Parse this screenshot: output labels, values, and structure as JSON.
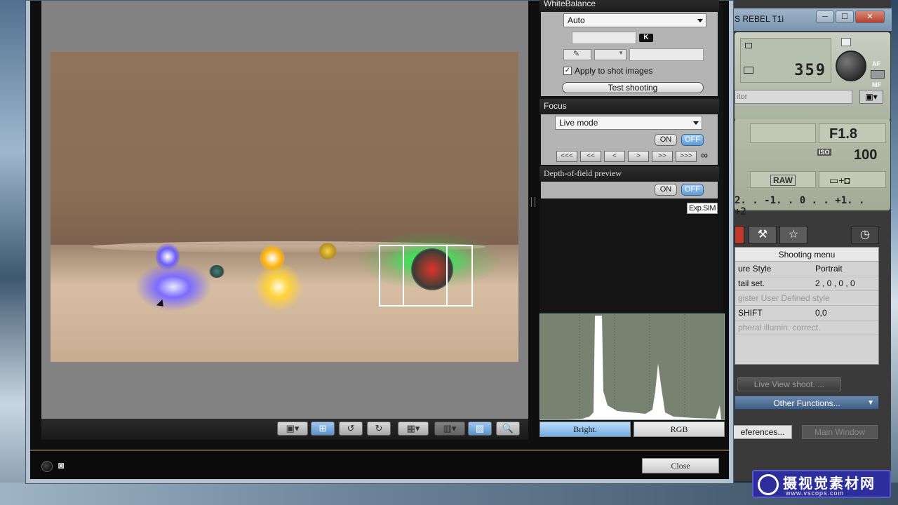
{
  "camera_window": {
    "title": "S REBEL T1i",
    "minimize": "─",
    "maximize": "☐",
    "close": "✕",
    "shots_remaining": "359",
    "af_label": "AF",
    "mf_label": "MF",
    "monitor_field": "itor",
    "aperture": "F1.8",
    "iso_label": "ISO",
    "iso": "100",
    "quality": "RAW",
    "exposure_scale": "2. . -1. . 0 . . +1. . +2",
    "menu": {
      "header": "Shooting menu",
      "rows": [
        {
          "key": "ure Style",
          "value": "Portrait",
          "dim": false
        },
        {
          "key": "tail set.",
          "value": "2 , 0 , 0 , 0",
          "dim": false
        },
        {
          "key": "gister User Defined style",
          "value": "",
          "dim": true
        },
        {
          "key": "SHIFT",
          "value": "0,0",
          "dim": false
        },
        {
          "key": "pheral illumin. correct.",
          "value": "",
          "dim": true
        }
      ]
    },
    "live_view_btn": "Live View shoot. ...",
    "other_functions": "Other Functions...",
    "preferences": "eferences...",
    "main_window": "Main Window"
  },
  "side": {
    "white_balance": {
      "heading": "WhiteBalance",
      "mode": "Auto",
      "kelvin_badge": "K",
      "apply_label": "Apply to shot images",
      "apply_checked": "✓",
      "test_button": "Test shooting"
    },
    "focus": {
      "heading": "Focus",
      "mode": "Live mode",
      "on": "ON",
      "off": "OFF",
      "nav": [
        "<<<",
        "<<",
        "<",
        ">",
        ">>",
        ">>>"
      ],
      "infinity": "∞"
    },
    "dof": {
      "heading": "Depth-of-field preview",
      "on": "ON",
      "off": "OFF"
    },
    "expsim": "Exp.SIM",
    "histogram_tabs": [
      "Bright.",
      "RGB"
    ]
  },
  "main": {
    "close_button": "Close",
    "toolbar_icons": [
      "▣▾",
      "⊞",
      "↺",
      "↻",
      "▦▾",
      "▥▾",
      "▨",
      "🔍"
    ]
  },
  "watermark": {
    "title": "摄视觉素材网",
    "url": "www.vscops.com"
  }
}
